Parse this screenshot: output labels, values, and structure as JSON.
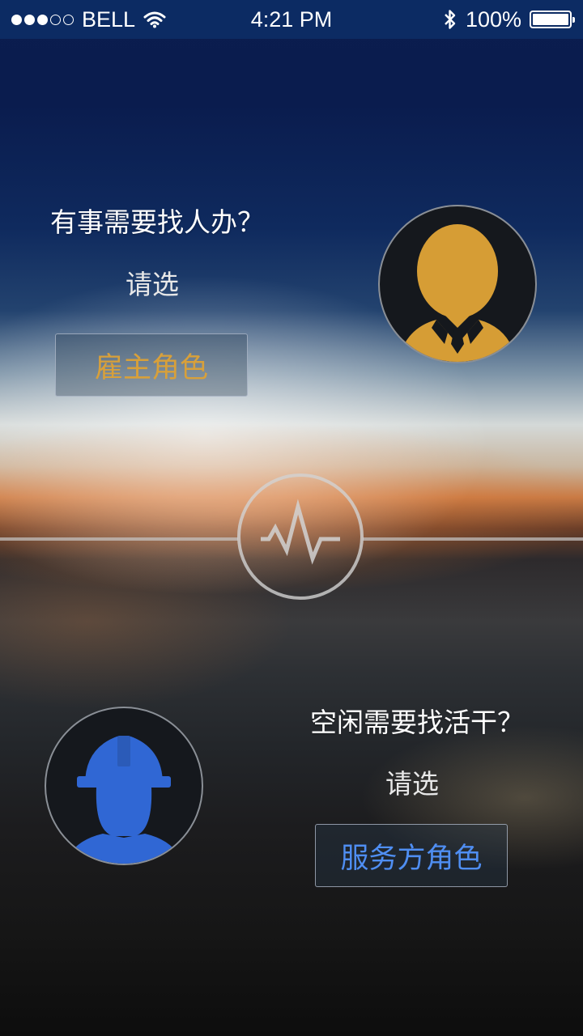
{
  "status_bar": {
    "signal_dots_filled": 3,
    "signal_dots_total": 5,
    "carrier": "BELL",
    "time": "4:21 PM",
    "battery": "100%",
    "icons": [
      "wifi-icon",
      "bluetooth-icon",
      "battery-icon"
    ]
  },
  "employer": {
    "question": "有事需要找人办？",
    "hint": "请选",
    "button_label": "雇主角色",
    "button_color": "#d8a03a",
    "avatar_color": "#d69d35"
  },
  "worker": {
    "question": "空闲需要找活干？",
    "hint": "请选",
    "button_label": "服务方角色",
    "button_color": "#4f8ef2",
    "avatar_color": "#3067d4"
  },
  "logo": {
    "icon": "pulse-icon"
  }
}
